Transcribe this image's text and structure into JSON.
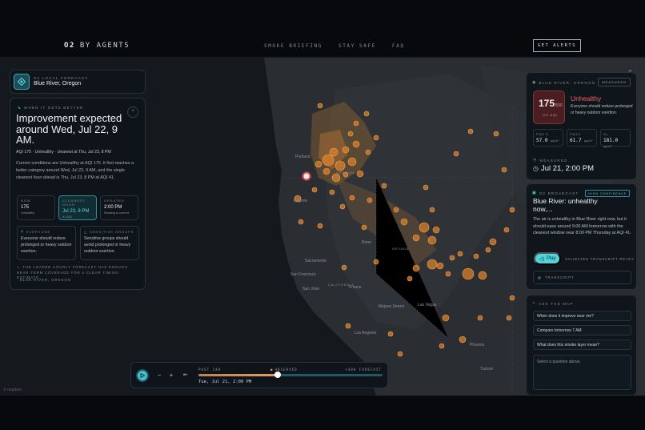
{
  "nav": {
    "brand_mark": "O2",
    "brand_sub": "BY AGENTS",
    "links": [
      "SMOKE BRIEFING",
      "STAY SAFE",
      "FAQ"
    ],
    "alerts_label": "GET ALERTS"
  },
  "location": {
    "kicker": "O2 LOCAL FORECAST",
    "name": "Blue River, Oregon"
  },
  "forecast": {
    "kicker": "WHEN IT GETS BETTER",
    "title": "Improvement expected around Wed, Jul 22, 9 AM.",
    "subtitle": "AQI 175 · Unhealthy · cleanest at Thu, Jul 23, 8 PM",
    "body": "Current conditions are Unhealthy at AQI 175. It first reaches a better category around Wed, Jul 22, 9 AM, and the single cleanest hour ahead is Thu, Jul 23, 8 PM at AQI 41.",
    "stats": [
      {
        "key": "NOW",
        "value": "175",
        "sub": "Unhealthy"
      },
      {
        "key": "CLEANEST HOUR",
        "value": "Jul 23, 8 PM",
        "sub": "41 AQI"
      },
      {
        "key": "UPDATED",
        "value": "2:00 PM",
        "sub": "Reading is current"
      }
    ],
    "groups": [
      {
        "key": "EVERYONE",
        "body": "Everyone should reduce prolonged or heavy outdoor exertion."
      },
      {
        "key": "SENSITIVE GROUPS",
        "body": "Sensitive groups should avoid prolonged or heavy outdoor exertion."
      }
    ],
    "note": "THE LOADED HOURLY FORECAST HAS ENOUGH NEAR-TERM COVERAGE FOR A CLEAR TIMING ESTIMATE.",
    "place": "BLUE RIVER, OREGON"
  },
  "aqi": {
    "kicker": "BLUE RIVER, OREGON",
    "badge": "MEASURED",
    "value": "175",
    "of": "/500",
    "unit": "US AQI",
    "category": "Unhealthy",
    "desc": "Everyone should reduce prolonged or heavy outdoor exertion.",
    "pollutants": [
      {
        "key": "PM2.5",
        "value": "57.0",
        "unit": "µg/m³"
      },
      {
        "key": "PM10",
        "value": "61.7",
        "unit": "µg/m³"
      },
      {
        "key": "O₃",
        "value": "181.0",
        "unit": "µg/m³"
      }
    ],
    "measured_label": "MEASURED",
    "measured_time": "Jul 21, 2:00 PM",
    "colors": {
      "unhealthy": "#f0606a"
    }
  },
  "broadcast": {
    "kicker": "O2 BROADCAST",
    "badge": "HIGH CONFIDENCE",
    "title": "Blue River: unhealthy now,...",
    "body": "The air is unhealthy in Blue River right now, but it should ease around 9:00 AM tomorrow with the cleanest window near 8:00 PM Thursday at AQI 41.",
    "play_label": "Play",
    "validated": "VALIDATED TRANSCRIPT READY",
    "transcript_label": "TRANSCRIPT"
  },
  "ask": {
    "kicker": "ASK THE MAP",
    "questions": [
      "When does it improve near me?",
      "Compare tomorrow 7 AM",
      "What does this smoke layer mean?"
    ],
    "prompt": "Select a question above."
  },
  "timeline": {
    "past": "PAST 24H",
    "observed": "OBSERVED",
    "forecast": "+48H FORECAST",
    "time": "Tue, Jul 21, 2:00 PM",
    "progress": 0.43
  },
  "map_labels": [
    "Portland",
    "Eugene",
    "Sacramento",
    "San Francisco",
    "San Jose",
    "Fresno",
    "Mojave Desert",
    "Los Angeles",
    "Phoenix",
    "Reno",
    "Las Vegas",
    "CALIFORNIA",
    "NEVADA",
    "OREGON",
    "Tucson"
  ],
  "attribution": "© mapbox"
}
